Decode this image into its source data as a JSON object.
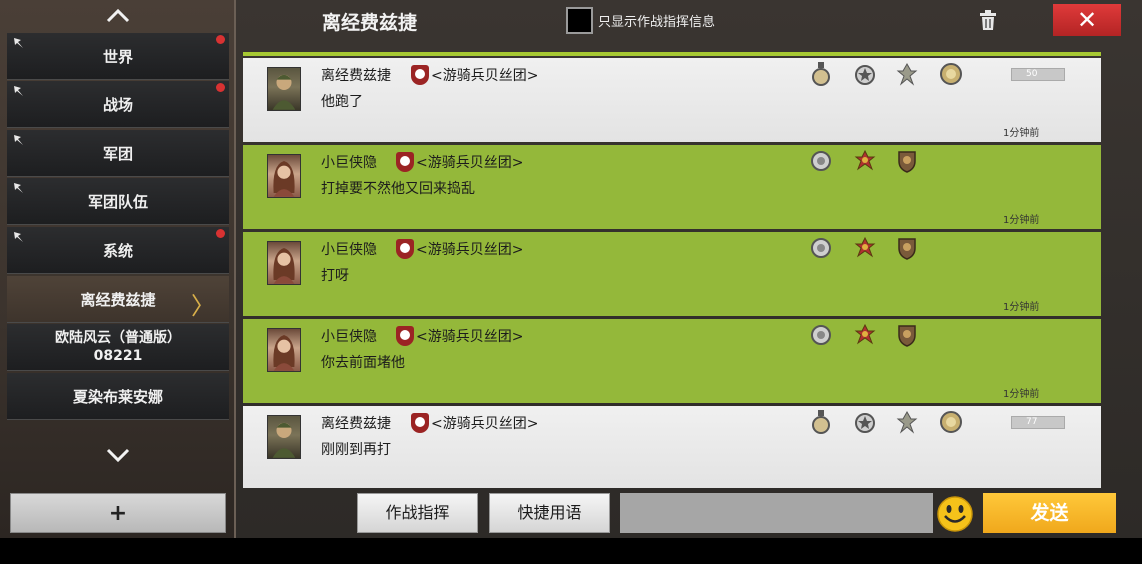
{
  "sidebar": {
    "items": [
      {
        "label": "世界",
        "pinned": true,
        "unread": true
      },
      {
        "label": "战场",
        "pinned": true,
        "unread": true
      },
      {
        "label": "军团",
        "pinned": true,
        "unread": false
      },
      {
        "label": "军团队伍",
        "pinned": true,
        "unread": false
      },
      {
        "label": "系统",
        "pinned": true,
        "unread": true
      },
      {
        "label": "离经费兹捷",
        "active": true
      },
      {
        "label_line1": "欧陆风云（普通版）",
        "label_line2": "08221"
      },
      {
        "label": "夏染布莱安娜"
      }
    ],
    "add_label": "+",
    "accent_color": "#d9b04a",
    "unread_color": "#d83232"
  },
  "header": {
    "title": "离经费兹捷",
    "filter_label": "只显示作战指挥信息",
    "close_label": "✕"
  },
  "messages": [
    {
      "sender": "离经费兹捷",
      "guild": "<游骑兵贝丝团>",
      "text": "他跑了",
      "time": "1分钟前",
      "style": "white",
      "avatar": "soldier",
      "level": "50"
    },
    {
      "sender": "小巨侠隐",
      "guild": "<游骑兵贝丝团>",
      "text": "打掉要不然他又回来捣乱",
      "time": "1分钟前",
      "style": "green",
      "avatar": "woman"
    },
    {
      "sender": "小巨侠隐",
      "guild": "<游骑兵贝丝团>",
      "text": "打呀",
      "time": "1分钟前",
      "style": "green",
      "avatar": "woman"
    },
    {
      "sender": "小巨侠隐",
      "guild": "<游骑兵贝丝团>",
      "text": "你去前面堵他",
      "time": "1分钟前",
      "style": "green",
      "avatar": "woman"
    },
    {
      "sender": "离经费兹捷",
      "guild": "<游骑兵贝丝团>",
      "text": "刚刚到再打",
      "time": "",
      "style": "white",
      "avatar": "soldier",
      "level": "77"
    }
  ],
  "bottom": {
    "command_label": "作战指挥",
    "quick_label": "快捷用语",
    "input_value": "",
    "input_placeholder": "",
    "send_label": "发送"
  },
  "colors": {
    "green_row": "#94b83a",
    "close_red": "#d83232",
    "send_orange": "#f0a81c"
  }
}
